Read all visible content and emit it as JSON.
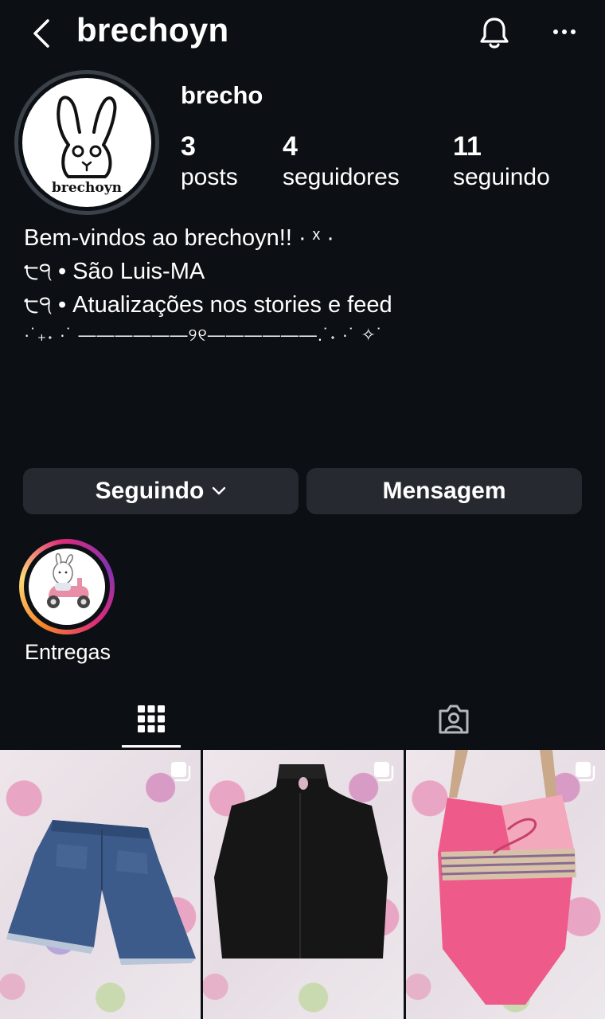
{
  "header": {
    "title": "brechoyn",
    "back_icon": "chevron-left-icon",
    "notifications_icon": "bell-icon",
    "more_icon": "more-horizontal-icon"
  },
  "profile": {
    "display_name": "brecho",
    "avatar_caption": "brechoyn",
    "stats": [
      {
        "value": "3",
        "label": "posts"
      },
      {
        "value": "4",
        "label": "seguidores"
      },
      {
        "value": "11",
        "label": "seguindo"
      }
    ],
    "bio": [
      "Bem-vindos ao brechoyn!! · ˣ ·",
      "੮੧ • São Luis-MA",
      "੮੧ • Atualizações nos stories e feed",
      "·˙₊˖ ·˙ ——————୨୧——————.˙˖ ·˙ ✧˙"
    ]
  },
  "actions": {
    "following_label": "Seguindo",
    "message_label": "Mensagem"
  },
  "highlights": [
    {
      "label": "Entregas"
    }
  ],
  "tabs": [
    {
      "name": "grid",
      "icon": "grid-icon",
      "active": true
    },
    {
      "name": "tagged",
      "icon": "tagged-person-icon",
      "active": false
    }
  ],
  "posts": [
    {
      "subject": "denim shorts",
      "multi": true
    },
    {
      "subject": "black top",
      "multi": true
    },
    {
      "subject": "pink bodysuit",
      "multi": true
    }
  ],
  "colors": {
    "background": "#0c1014",
    "button": "#26292f",
    "text": "#ffffff",
    "avatar_ring": "#3b4149"
  }
}
